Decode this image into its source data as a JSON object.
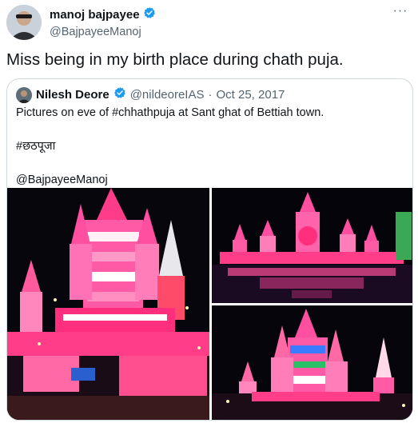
{
  "tweet": {
    "author_name": "manoj bajpayee",
    "author_handle": "@BajpayeeManoj",
    "more_icon": "more-icon",
    "verified_icon": "verified-badge-icon",
    "text": "Miss being in my birth place during chath puja."
  },
  "quoted_tweet": {
    "author_name": "Nilesh Deore",
    "author_handle": "@nildeoreIAS",
    "separator": "·",
    "date": "Oct 25, 2017",
    "lines": [
      "Pictures on eve of #chhathpuja at Sant ghat of Bettiah town.",
      "#छठपूजा",
      "@BajpayeeManoj"
    ],
    "media": [
      "photo-lit-temple-closeup",
      "photo-lit-temple-reflection",
      "photo-lit-temple-night"
    ]
  },
  "colors": {
    "text_primary": "#0f1419",
    "text_secondary": "#536471",
    "verified": "#1d9bf0",
    "border": "#cfd9de"
  }
}
